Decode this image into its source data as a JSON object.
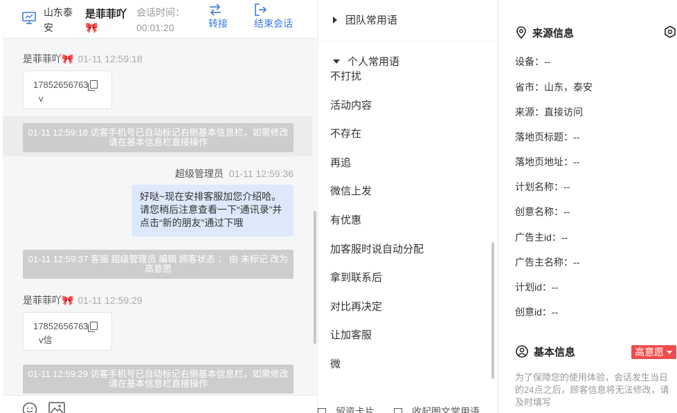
{
  "header": {
    "location": "山东泰安",
    "visitor_name": "是菲菲吖🎀",
    "session_time_label": "会话时间：",
    "session_time_value": "00:01:20",
    "transfer_label": "转接",
    "end_session_label": "结束会话"
  },
  "messages": {
    "m1": {
      "sender": "是菲菲吖🎀",
      "time": "01-11 12:59:18",
      "card_phone": "17852656763",
      "card_sub": "v"
    },
    "sys1": {
      "text": "01-11 12:59:18 访客手机号已自动标记右侧基本信息栏，如需修改请在基本信息栏直接操作"
    },
    "m2": {
      "sender": "超级管理员",
      "time": "01-11 12:59:36",
      "text": "好哒~现在安排客服加您介绍哈。请您稍后注意查看一下“通讯录”并点击“新的朋友”通过下哦"
    },
    "sys2": {
      "text": "01-11 12:59:37 客服 超级管理员 编辑 顾客状态 ： 由 未标记 改为 高意愿"
    },
    "m3": {
      "sender": "是菲菲吖🎀",
      "time": "01-11 12:59:29",
      "card_phone": "17852656763",
      "card_sub": "v信"
    },
    "sys3": {
      "text": "01-11 12:59:29 访客手机号已自动标记右侧基本信息栏，如需修改请在基本信息栏直接操作"
    }
  },
  "phrases": {
    "team_group": "团队常用语",
    "personal_group": "个人常用语",
    "items": [
      "不打扰",
      "活动内容",
      "不存在",
      "再追",
      "微信上发",
      "有优惠",
      "加客服时说自动分配",
      "拿到联系后",
      "对比再决定",
      "让加客服",
      "微"
    ],
    "footer_left": "留资卡片",
    "footer_right": "收起图文常用语"
  },
  "info": {
    "source_title": "来源信息",
    "fields": [
      "设备：--",
      "省市：山东，泰安",
      "来源：直接访问",
      "落地页标题：--",
      "落地页地址：--",
      "计划名称：--",
      "创意名称：--",
      "广告主id：--",
      "广告主名称：--",
      "计划id：--",
      "创意id：--"
    ],
    "basic_title": "基本信息",
    "intent_badge": "高意愿",
    "notice": "为了保障您的使用体验，会话发生当日的24点之后，顾客信息将无法修改，请及时填写"
  },
  "colors": {
    "accent": "#3a7be0",
    "badge": "#f04b4b",
    "bubble": "#dde9fb",
    "system": "#cdcdcd"
  }
}
